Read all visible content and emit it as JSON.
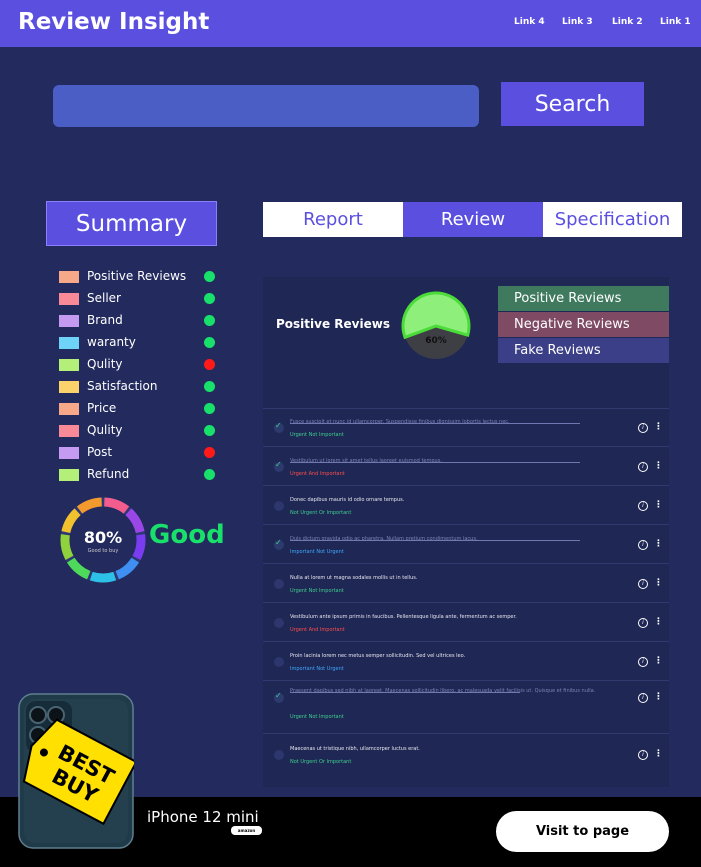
{
  "header": {
    "title": "Review Insight",
    "links": [
      "Link 4",
      "Link 3",
      "Link 2",
      "Link 1"
    ]
  },
  "search": {
    "value": "",
    "placeholder": "",
    "button_label": "Search"
  },
  "summary": {
    "title": "Summary",
    "items": [
      {
        "label": "Positive Reviews",
        "swatch": "#f7a889",
        "status": "#19e06a"
      },
      {
        "label": "Seller",
        "swatch": "#f78a96",
        "status": "#19e06a"
      },
      {
        "label": "Brand",
        "swatch": "#c59bf2",
        "status": "#19e06a"
      },
      {
        "label": "waranty",
        "swatch": "#6fd3f7",
        "status": "#19e06a"
      },
      {
        "label": "Qulity",
        "swatch": "#b4ef7a",
        "status": "#ff1a1a"
      },
      {
        "label": "Satisfaction",
        "swatch": "#fcd36b",
        "status": "#19e06a"
      },
      {
        "label": "Price",
        "swatch": "#f7a889",
        "status": "#19e06a"
      },
      {
        "label": "Qulity",
        "swatch": "#f78a96",
        "status": "#19e06a"
      },
      {
        "label": "Post",
        "swatch": "#c59bf2",
        "status": "#ff1a1a"
      },
      {
        "label": "Refund",
        "swatch": "#b4ef7a",
        "status": "#19e06a"
      }
    ],
    "score": {
      "value": "80%",
      "sub": "Good to buy",
      "status": "Good",
      "fraction": 0.8,
      "segment_colors": [
        "#f25d8e",
        "#9b47e8",
        "#7a3cf0",
        "#3f8ef2",
        "#2ec1e8",
        "#4fd95a",
        "#8fd23b",
        "#f2c12e",
        "#f29a2e"
      ]
    }
  },
  "tabs": [
    {
      "label": "Report",
      "active": false
    },
    {
      "label": "Review",
      "active": true
    },
    {
      "label": "Specification",
      "active": false
    }
  ],
  "review_panel": {
    "title": "Positive Reviews",
    "pie": {
      "label": "60%",
      "fraction": 0.6,
      "fill": "#8ef07b",
      "rest": "#3e3e45"
    },
    "legend": [
      {
        "label": "Positive Reviews",
        "color": "#3f7a5f"
      },
      {
        "label": "Negative Reviews",
        "color": "#7f4a63"
      },
      {
        "label": "Fake Reviews",
        "color": "#3a3f87"
      }
    ]
  },
  "reviews": [
    {
      "text": "Fusce suscipit et nunc id ullamcorper. Suspendisse finibus dignissim lobortis lectus nec.",
      "tag": "Urgent Not Important",
      "tag_color": "#3ecf8e",
      "done": true
    },
    {
      "text": "Vestibulum ut lorem sit amet tellus laoreet euismod tempus.",
      "tag": "Urgent And Important",
      "tag_color": "#ff4d4d",
      "done": true
    },
    {
      "text": "Donec dapibus mauris id odio ornare tempus.",
      "tag": "Not Urgent Or Important",
      "tag_color": "#3ecf8e",
      "done": false
    },
    {
      "text": "Duis dictum gravida odio ac pharetra. Nullam pretium condimentum lacus.",
      "tag": "Important Not Urgent",
      "tag_color": "#3ea8ff",
      "done": true
    },
    {
      "text": "Nulla at lorem ut magna sodales mollis ut in tellus.",
      "tag": "Urgent Not Important",
      "tag_color": "#3ecf8e",
      "done": false
    },
    {
      "text": "Vestibulum ante ipsum primis in faucibus. Pellentesque ligula ante, fermentum ac semper.",
      "tag": "Urgent And Important",
      "tag_color": "#ff4d4d",
      "done": false
    },
    {
      "text": "Proin lacinia lorem nec metus semper sollicitudin. Sed vel ultrices leo.",
      "tag": "Important Not Urgent",
      "tag_color": "#3ea8ff",
      "done": false
    },
    {
      "text": "Praesent dapibus sed nibh at laoreet. Maecenas sollicitudin libero, ac malesuada velit facilisis ut. Quisque et finibus nulla.",
      "tag": "Urgent Not Important",
      "tag_color": "#3ecf8e",
      "done": true
    },
    {
      "text": "Maecenas ut tristique nibh, ullamcorper luctus erat.",
      "tag": "Not Urgent Or Important",
      "tag_color": "#3ecf8e",
      "done": false
    }
  ],
  "product": {
    "name": "iPhone 12 mini",
    "store_badge": "amazon",
    "sticker": "BEST BUY",
    "button_label": "Visit to page"
  }
}
